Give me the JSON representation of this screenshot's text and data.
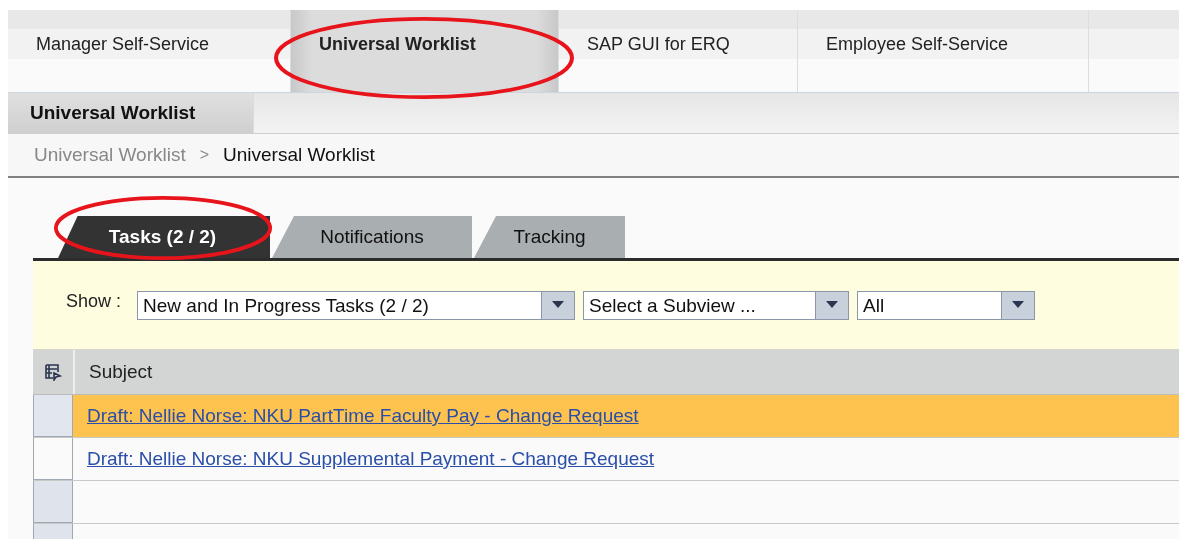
{
  "top_tabs": [
    {
      "label": "Manager Self-Service",
      "selected": false,
      "circled": false
    },
    {
      "label": "Universal Worklist",
      "selected": true,
      "circled": true
    },
    {
      "label": "SAP GUI for ERQ",
      "selected": false,
      "circled": false
    },
    {
      "label": "Employee Self-Service",
      "selected": false,
      "circled": false
    }
  ],
  "sub_tabs": [
    {
      "label": "Universal Worklist",
      "selected": true
    }
  ],
  "breadcrumb": [
    {
      "label": "Universal Worklist",
      "current": false
    },
    {
      "label": "Universal Worklist",
      "current": true
    }
  ],
  "breadcrumb_separator": ">",
  "worklist_tabs": [
    {
      "label": "Tasks  (2 / 2)",
      "selected": true,
      "circled": true
    },
    {
      "label": "Notifications",
      "selected": false,
      "circled": false
    },
    {
      "label": "Tracking",
      "selected": false,
      "circled": false
    }
  ],
  "filter": {
    "label": "Show :",
    "dropdowns": [
      {
        "value": "New  and In Progress Tasks  (2 / 2)"
      },
      {
        "value": "Select a Subview ..."
      },
      {
        "value": "All"
      }
    ]
  },
  "table": {
    "columns": [
      "Subject"
    ],
    "rows": [
      {
        "subject": "Draft: Nellie Norse: NKU PartTime Faculty Pay - Change Request",
        "selected": true
      },
      {
        "subject": "Draft: Nellie Norse: NKU Supplemental Payment - Change Request",
        "selected": false
      }
    ]
  }
}
